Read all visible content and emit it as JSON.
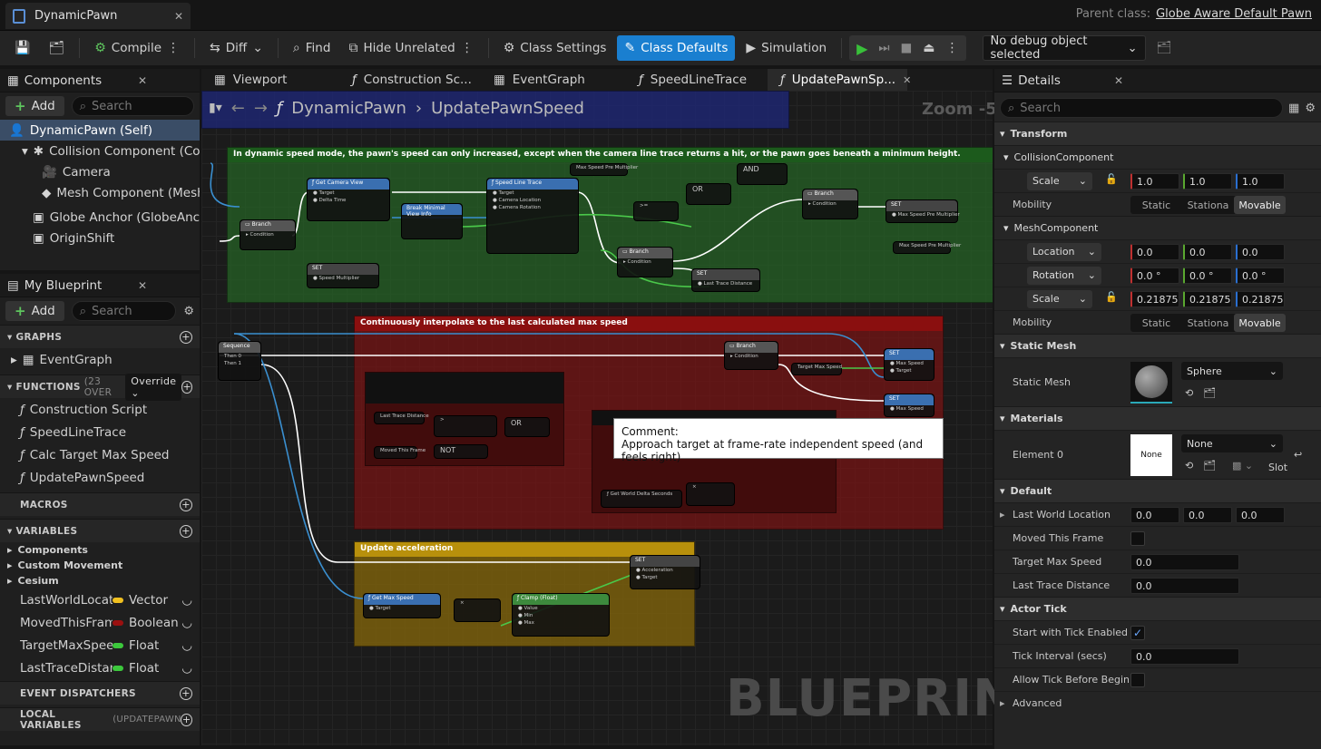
{
  "titlebar": {
    "doc_tab": "DynamicPawn",
    "parent_class_label": "Parent class:",
    "parent_class_value": "Globe Aware Default Pawn"
  },
  "toolbar": {
    "compile": "Compile",
    "diff": "Diff",
    "find": "Find",
    "hide_unrelated": "Hide Unrelated",
    "class_settings": "Class Settings",
    "class_defaults": "Class Defaults",
    "simulation": "Simulation",
    "debug_object": "No debug object selected"
  },
  "components": {
    "tab": "Components",
    "add": "Add",
    "search_placeholder": "Search",
    "items": [
      "DynamicPawn (Self)",
      "Collision Component (Col",
      "Camera",
      "Mesh Component (Mesh",
      "Globe Anchor (GlobeAnch",
      "OriginShift"
    ]
  },
  "my_blueprint": {
    "tab": "My Blueprint",
    "add": "Add",
    "search_placeholder": "Search",
    "graphs": "GRAPHS",
    "event_graph": "EventGraph",
    "functions": "FUNCTIONS",
    "functions_count": "(23 OVER",
    "override": "Override",
    "function_items": [
      "Construction Script",
      "SpeedLineTrace",
      "Calc Target Max Speed",
      "UpdatePawnSpeed"
    ],
    "macros": "MACROS",
    "variables": "VARIABLES",
    "var_groups": [
      "Components",
      "Custom Movement",
      "Cesium"
    ],
    "vars": [
      {
        "name": "LastWorldLocatio",
        "type": "Vector",
        "color": "#f0c020"
      },
      {
        "name": "MovedThisFrame",
        "type": "Boolean",
        "color": "#9a1010"
      },
      {
        "name": "TargetMaxSpeed",
        "type": "Float",
        "color": "#3cc83c"
      },
      {
        "name": "LastTraceDistanc",
        "type": "Float",
        "color": "#3cc83c"
      }
    ],
    "event_dispatchers": "EVENT DISPATCHERS",
    "local_variables": "LOCAL VARIABLES",
    "local_variables_sub": "(UPDATEPAWNSPE"
  },
  "graph_tabs": [
    "Viewport",
    "Construction Sc...",
    "EventGraph",
    "SpeedLineTrace",
    "UpdatePawnSp..."
  ],
  "graph": {
    "breadcrumb_root": "DynamicPawn",
    "breadcrumb_leaf": "UpdatePawnSpeed",
    "zoom": "Zoom -5",
    "watermark": "BLUEPRINT",
    "comments": [
      "In dynamic speed mode, the pawn's speed can only increased, except when the camera line trace returns a hit, or the pawn goes beneath a minimum height.",
      "Continuously interpolate to the last calculated max speed",
      "Update acceleration"
    ],
    "tooltip_title": "Comment:",
    "tooltip_body": "Approach target at frame-rate independent speed (and feels right)"
  },
  "details": {
    "tab": "Details",
    "search_placeholder": "Search",
    "transform": "Transform",
    "collision_component": "CollisionComponent",
    "mesh_component": "MeshComponent",
    "scale": "Scale",
    "location": "Location",
    "rotation": "Rotation",
    "mobility": "Mobility",
    "mobility_options": [
      "Static",
      "Stationa",
      "Movable"
    ],
    "collision_scale": [
      "1.0",
      "1.0",
      "1.0"
    ],
    "mesh_location": [
      "0.0",
      "0.0",
      "0.0"
    ],
    "mesh_rotation": [
      "0.0 °",
      "0.0 °",
      "0.0 °"
    ],
    "mesh_scale": [
      "0.21875",
      "0.21875",
      "0.21875"
    ],
    "static_mesh_section": "Static Mesh",
    "static_mesh_label": "Static Mesh",
    "static_mesh_value": "Sphere",
    "materials": "Materials",
    "element0": "Element 0",
    "element0_thumb": "None",
    "element0_value": "None",
    "slot": "Slot",
    "default": "Default",
    "last_world_location": "Last World Location",
    "lwl_values": [
      "0.0",
      "0.0",
      "0.0"
    ],
    "moved_this_frame": "Moved This Frame",
    "target_max_speed": "Target Max Speed",
    "tms_value": "0.0",
    "last_trace_distance": "Last Trace Distance",
    "ltd_value": "0.0",
    "actor_tick": "Actor Tick",
    "start_with_tick": "Start with Tick Enabled",
    "tick_interval": "Tick Interval (secs)",
    "tick_interval_value": "0.0",
    "allow_tick": "Allow Tick Before Begin...",
    "advanced": "Advanced"
  }
}
